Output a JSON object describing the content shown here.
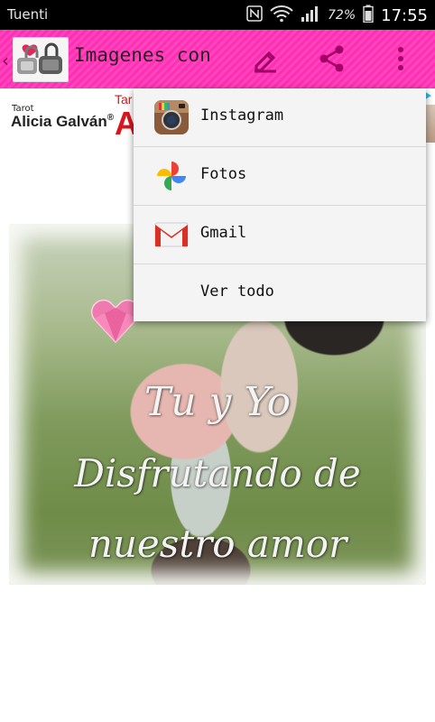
{
  "status_bar": {
    "carrier": "Tuenti",
    "battery_percent": "72%",
    "time": "17:55"
  },
  "app_bar": {
    "back_glyph": "‹",
    "title": "Imagenes con frases de amor",
    "icons": [
      "back-icon",
      "app-logo",
      "edit-icon",
      "share-icon",
      "overflow-menu-icon"
    ]
  },
  "ad": {
    "small_label": "Tarot",
    "brand": "Alicia Galván",
    "registered": "®",
    "red_text_top": "Tar",
    "red_text_big": "A",
    "colors": {
      "red": "#d7161d",
      "adchoices": "#39b5e8"
    }
  },
  "photo": {
    "line1": "Tu y Yo",
    "line2": "Disfrutando de",
    "line3": "nuestro amor"
  },
  "share_menu": {
    "items": [
      {
        "label": "Instagram",
        "icon": "instagram-icon"
      },
      {
        "label": "Fotos",
        "icon": "photos-icon"
      },
      {
        "label": "Gmail",
        "icon": "gmail-icon"
      },
      {
        "label": "Ver todo",
        "icon": ""
      }
    ]
  },
  "colors": {
    "app_bar_pink": "#ff2fb4",
    "status_bar": "#000000",
    "menu_bg": "#f4f4f4"
  }
}
